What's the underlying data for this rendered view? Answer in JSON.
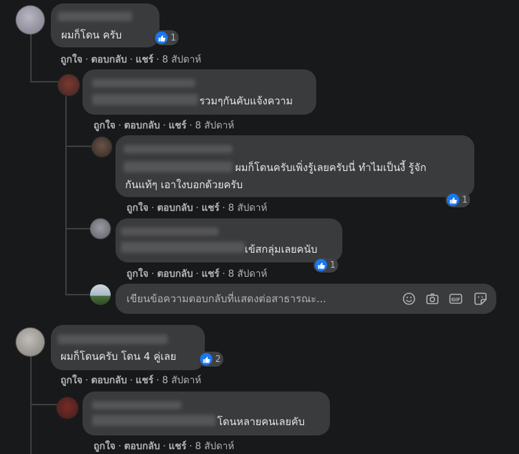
{
  "actions": {
    "like": "ถูกใจ",
    "reply": "ตอบกลับ",
    "share": "แชร์",
    "sep": "·"
  },
  "comments": [
    {
      "text": "ผมก็โดน ครับ",
      "time": "8 สัปดาห์",
      "likes": "1"
    },
    {
      "text": "รวมๆกันคับแจ้งความ",
      "time": "8 สัปดาห์"
    },
    {
      "text_line1": "ผมก็โดนครับเพิ่งรู้เลยครับนี่ ทำไมเป็นงี้ รู้จัก",
      "text_line2": "กันแท้ๆ เอาใงบอกด้วยครับ",
      "time": "8 สัปดาห์",
      "likes": "1"
    },
    {
      "text": "เข้สกลุ่มเลยคนับ",
      "time": "8 สัปดาห์",
      "likes": "1"
    },
    {
      "text": "ผมก็โดนครับ โดน 4 คู่เลย",
      "time": "8 สัปดาห์",
      "likes": "2"
    },
    {
      "text": "โดนหลายคนเลยคับ",
      "time": "8 สัปดาห์"
    }
  ],
  "composer": {
    "placeholder": "เขียนข้อความตอบกลับที่แสดงต่อสาธารณะ..."
  },
  "icons": [
    "emoji-icon",
    "camera-icon",
    "gif-icon",
    "sticker-icon"
  ],
  "colors": {
    "background": "#18191a",
    "bubble": "#3a3b3c",
    "like_blue": "#1877f2",
    "muted_text": "#b0b3b8"
  }
}
